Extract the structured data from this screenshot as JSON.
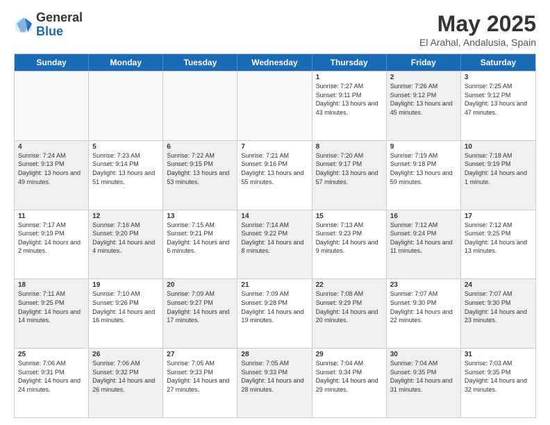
{
  "logo": {
    "general": "General",
    "blue": "Blue"
  },
  "title": "May 2025",
  "subtitle": "El Arahal, Andalusia, Spain",
  "days": [
    "Sunday",
    "Monday",
    "Tuesday",
    "Wednesday",
    "Thursday",
    "Friday",
    "Saturday"
  ],
  "weeks": [
    [
      {
        "num": "",
        "sunrise": "",
        "sunset": "",
        "daylight": "",
        "shaded": false,
        "empty": true
      },
      {
        "num": "",
        "sunrise": "",
        "sunset": "",
        "daylight": "",
        "shaded": false,
        "empty": true
      },
      {
        "num": "",
        "sunrise": "",
        "sunset": "",
        "daylight": "",
        "shaded": false,
        "empty": true
      },
      {
        "num": "",
        "sunrise": "",
        "sunset": "",
        "daylight": "",
        "shaded": false,
        "empty": true
      },
      {
        "num": "1",
        "sunrise": "Sunrise: 7:27 AM",
        "sunset": "Sunset: 9:11 PM",
        "daylight": "Daylight: 13 hours and 43 minutes.",
        "shaded": false,
        "empty": false
      },
      {
        "num": "2",
        "sunrise": "Sunrise: 7:26 AM",
        "sunset": "Sunset: 9:12 PM",
        "daylight": "Daylight: 13 hours and 45 minutes.",
        "shaded": true,
        "empty": false
      },
      {
        "num": "3",
        "sunrise": "Sunrise: 7:25 AM",
        "sunset": "Sunset: 9:12 PM",
        "daylight": "Daylight: 13 hours and 47 minutes.",
        "shaded": false,
        "empty": false
      }
    ],
    [
      {
        "num": "4",
        "sunrise": "Sunrise: 7:24 AM",
        "sunset": "Sunset: 9:13 PM",
        "daylight": "Daylight: 13 hours and 49 minutes.",
        "shaded": true,
        "empty": false
      },
      {
        "num": "5",
        "sunrise": "Sunrise: 7:23 AM",
        "sunset": "Sunset: 9:14 PM",
        "daylight": "Daylight: 13 hours and 51 minutes.",
        "shaded": false,
        "empty": false
      },
      {
        "num": "6",
        "sunrise": "Sunrise: 7:22 AM",
        "sunset": "Sunset: 9:15 PM",
        "daylight": "Daylight: 13 hours and 53 minutes.",
        "shaded": true,
        "empty": false
      },
      {
        "num": "7",
        "sunrise": "Sunrise: 7:21 AM",
        "sunset": "Sunset: 9:16 PM",
        "daylight": "Daylight: 13 hours and 55 minutes.",
        "shaded": false,
        "empty": false
      },
      {
        "num": "8",
        "sunrise": "Sunrise: 7:20 AM",
        "sunset": "Sunset: 9:17 PM",
        "daylight": "Daylight: 13 hours and 57 minutes.",
        "shaded": true,
        "empty": false
      },
      {
        "num": "9",
        "sunrise": "Sunrise: 7:19 AM",
        "sunset": "Sunset: 9:18 PM",
        "daylight": "Daylight: 13 hours and 59 minutes.",
        "shaded": false,
        "empty": false
      },
      {
        "num": "10",
        "sunrise": "Sunrise: 7:18 AM",
        "sunset": "Sunset: 9:19 PM",
        "daylight": "Daylight: 14 hours and 1 minute.",
        "shaded": true,
        "empty": false
      }
    ],
    [
      {
        "num": "11",
        "sunrise": "Sunrise: 7:17 AM",
        "sunset": "Sunset: 9:19 PM",
        "daylight": "Daylight: 14 hours and 2 minutes.",
        "shaded": false,
        "empty": false
      },
      {
        "num": "12",
        "sunrise": "Sunrise: 7:16 AM",
        "sunset": "Sunset: 9:20 PM",
        "daylight": "Daylight: 14 hours and 4 minutes.",
        "shaded": true,
        "empty": false
      },
      {
        "num": "13",
        "sunrise": "Sunrise: 7:15 AM",
        "sunset": "Sunset: 9:21 PM",
        "daylight": "Daylight: 14 hours and 6 minutes.",
        "shaded": false,
        "empty": false
      },
      {
        "num": "14",
        "sunrise": "Sunrise: 7:14 AM",
        "sunset": "Sunset: 9:22 PM",
        "daylight": "Daylight: 14 hours and 8 minutes.",
        "shaded": true,
        "empty": false
      },
      {
        "num": "15",
        "sunrise": "Sunrise: 7:13 AM",
        "sunset": "Sunset: 9:23 PM",
        "daylight": "Daylight: 14 hours and 9 minutes.",
        "shaded": false,
        "empty": false
      },
      {
        "num": "16",
        "sunrise": "Sunrise: 7:12 AM",
        "sunset": "Sunset: 9:24 PM",
        "daylight": "Daylight: 14 hours and 11 minutes.",
        "shaded": true,
        "empty": false
      },
      {
        "num": "17",
        "sunrise": "Sunrise: 7:12 AM",
        "sunset": "Sunset: 9:25 PM",
        "daylight": "Daylight: 14 hours and 13 minutes.",
        "shaded": false,
        "empty": false
      }
    ],
    [
      {
        "num": "18",
        "sunrise": "Sunrise: 7:11 AM",
        "sunset": "Sunset: 9:25 PM",
        "daylight": "Daylight: 14 hours and 14 minutes.",
        "shaded": true,
        "empty": false
      },
      {
        "num": "19",
        "sunrise": "Sunrise: 7:10 AM",
        "sunset": "Sunset: 9:26 PM",
        "daylight": "Daylight: 14 hours and 16 minutes.",
        "shaded": false,
        "empty": false
      },
      {
        "num": "20",
        "sunrise": "Sunrise: 7:09 AM",
        "sunset": "Sunset: 9:27 PM",
        "daylight": "Daylight: 14 hours and 17 minutes.",
        "shaded": true,
        "empty": false
      },
      {
        "num": "21",
        "sunrise": "Sunrise: 7:09 AM",
        "sunset": "Sunset: 9:28 PM",
        "daylight": "Daylight: 14 hours and 19 minutes.",
        "shaded": false,
        "empty": false
      },
      {
        "num": "22",
        "sunrise": "Sunrise: 7:08 AM",
        "sunset": "Sunset: 9:29 PM",
        "daylight": "Daylight: 14 hours and 20 minutes.",
        "shaded": true,
        "empty": false
      },
      {
        "num": "23",
        "sunrise": "Sunrise: 7:07 AM",
        "sunset": "Sunset: 9:30 PM",
        "daylight": "Daylight: 14 hours and 22 minutes.",
        "shaded": false,
        "empty": false
      },
      {
        "num": "24",
        "sunrise": "Sunrise: 7:07 AM",
        "sunset": "Sunset: 9:30 PM",
        "daylight": "Daylight: 14 hours and 23 minutes.",
        "shaded": true,
        "empty": false
      }
    ],
    [
      {
        "num": "25",
        "sunrise": "Sunrise: 7:06 AM",
        "sunset": "Sunset: 9:31 PM",
        "daylight": "Daylight: 14 hours and 24 minutes.",
        "shaded": false,
        "empty": false
      },
      {
        "num": "26",
        "sunrise": "Sunrise: 7:06 AM",
        "sunset": "Sunset: 9:32 PM",
        "daylight": "Daylight: 14 hours and 26 minutes.",
        "shaded": true,
        "empty": false
      },
      {
        "num": "27",
        "sunrise": "Sunrise: 7:05 AM",
        "sunset": "Sunset: 9:33 PM",
        "daylight": "Daylight: 14 hours and 27 minutes.",
        "shaded": false,
        "empty": false
      },
      {
        "num": "28",
        "sunrise": "Sunrise: 7:05 AM",
        "sunset": "Sunset: 9:33 PM",
        "daylight": "Daylight: 14 hours and 28 minutes.",
        "shaded": true,
        "empty": false
      },
      {
        "num": "29",
        "sunrise": "Sunrise: 7:04 AM",
        "sunset": "Sunset: 9:34 PM",
        "daylight": "Daylight: 14 hours and 29 minutes.",
        "shaded": false,
        "empty": false
      },
      {
        "num": "30",
        "sunrise": "Sunrise: 7:04 AM",
        "sunset": "Sunset: 9:35 PM",
        "daylight": "Daylight: 14 hours and 31 minutes.",
        "shaded": true,
        "empty": false
      },
      {
        "num": "31",
        "sunrise": "Sunrise: 7:03 AM",
        "sunset": "Sunset: 9:35 PM",
        "daylight": "Daylight: 14 hours and 32 minutes.",
        "shaded": false,
        "empty": false
      }
    ]
  ]
}
